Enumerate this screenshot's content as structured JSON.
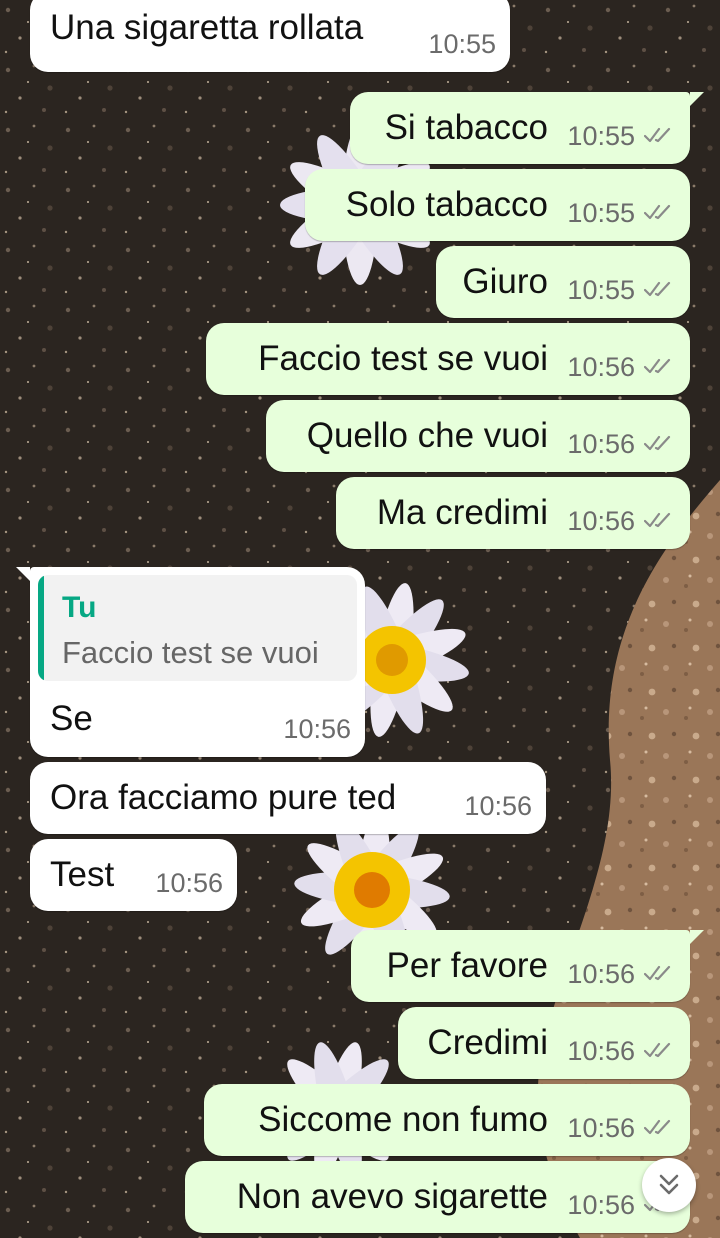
{
  "theme": {
    "incoming_bg": "#ffffff",
    "outgoing_bg": "#e7ffdb",
    "reply_accent": "#06a884",
    "read_tick": "#8a8a8a"
  },
  "messages": [
    {
      "direction": "in",
      "text": "Una sigaretta rollata",
      "time": "10:55"
    },
    {
      "direction": "out",
      "text": "Si tabacco",
      "time": "10:55",
      "status": "read"
    },
    {
      "direction": "out",
      "text": "Solo tabacco",
      "time": "10:55",
      "status": "read"
    },
    {
      "direction": "out",
      "text": "Giuro",
      "time": "10:55",
      "status": "read"
    },
    {
      "direction": "out",
      "text": "Faccio test se vuoi",
      "time": "10:56",
      "status": "read"
    },
    {
      "direction": "out",
      "text": "Quello che vuoi",
      "time": "10:56",
      "status": "read"
    },
    {
      "direction": "out",
      "text": "Ma credimi",
      "time": "10:56",
      "status": "read"
    },
    {
      "direction": "in",
      "text": "Se",
      "time": "10:56",
      "reply": {
        "author": "Tu",
        "text": "Faccio test se vuoi"
      }
    },
    {
      "direction": "in",
      "text": "Ora facciamo pure ted",
      "time": "10:56"
    },
    {
      "direction": "in",
      "text": "Test",
      "time": "10:56"
    },
    {
      "direction": "out",
      "text": "Per favore",
      "time": "10:56",
      "status": "read"
    },
    {
      "direction": "out",
      "text": "Credimi",
      "time": "10:56",
      "status": "read"
    },
    {
      "direction": "out",
      "text": "Siccome non fumo",
      "time": "10:56",
      "status": "read"
    },
    {
      "direction": "out",
      "text": "Non avevo sigarette",
      "time": "10:56",
      "status": "read"
    }
  ],
  "scroll_button_icon": "double-chevron-down-icon"
}
